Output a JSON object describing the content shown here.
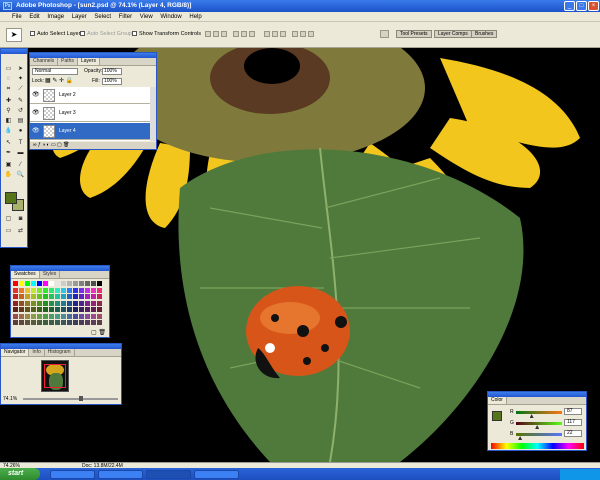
{
  "window": {
    "title": "Adobe Photoshop - [sun2.psd @ 74.1% (Layer 4, RGB/8)]",
    "app_icon": "Ps",
    "min": "_",
    "max": "□",
    "close": "×"
  },
  "menu": {
    "items": [
      "File",
      "Edit",
      "Image",
      "Layer",
      "Select",
      "Filter",
      "View",
      "Window",
      "Help"
    ]
  },
  "options": {
    "auto_select_layer": "Auto Select Layer",
    "auto_select_groups": "Auto Select Groups",
    "show_transform_controls": "Show Transform Controls",
    "well_tabs": [
      "Tool Presets",
      "Layer Comps",
      "Brushes"
    ]
  },
  "layers_panel": {
    "tabs": [
      "Channels",
      "Paths",
      "Layers"
    ],
    "blend_mode": "Normal",
    "opacity_label": "Opacity:",
    "opacity": "100%",
    "lock_label": "Lock:",
    "fill_label": "Fill:",
    "fill": "100%",
    "layers": [
      "Layer 2",
      "Layer 3",
      "Layer 4"
    ],
    "selected": "Layer 4"
  },
  "swatches_panel": {
    "tabs": [
      "Swatches",
      "Styles"
    ]
  },
  "navigator_panel": {
    "tabs": [
      "Navigator",
      "Info",
      "Histogram"
    ],
    "zoom": "74.1%"
  },
  "color_panel": {
    "tabs": [
      "Color"
    ],
    "r_label": "R",
    "g_label": "G",
    "b_label": "B",
    "r": "87",
    "g": "117",
    "b": "22",
    "r_fraction": 0.34,
    "g_fraction": 0.46,
    "b_fraction": 0.09
  },
  "status": {
    "zoom": "74.26%",
    "doc": "Doc: 13.8M/22.4M"
  },
  "taskbar": {
    "start": "start"
  },
  "colors": {
    "foreground": "#57751a",
    "background": "#a8b26a",
    "titlebar": "#1c52c9"
  }
}
